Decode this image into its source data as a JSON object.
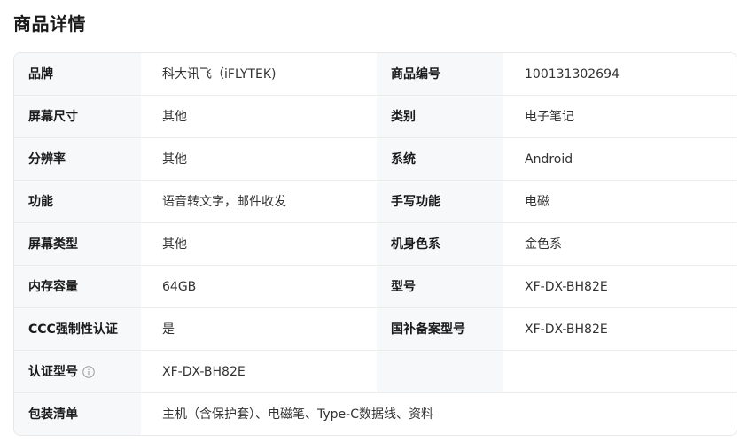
{
  "section": {
    "title": "商品详情"
  },
  "specs": {
    "rows": [
      {
        "l1": "品牌",
        "v1": "科大讯飞（iFLYTEK)",
        "l2": "商品编号",
        "v2": "100131302694"
      },
      {
        "l1": "屏幕尺寸",
        "v1": "其他",
        "l2": "类别",
        "v2": "电子笔记"
      },
      {
        "l1": "分辨率",
        "v1": "其他",
        "l2": "系统",
        "v2": "Android"
      },
      {
        "l1": "功能",
        "v1": "语音转文字，邮件收发",
        "l2": "手写功能",
        "v2": "电磁"
      },
      {
        "l1": "屏幕类型",
        "v1": "其他",
        "l2": "机身色系",
        "v2": "金色系"
      },
      {
        "l1": "内存容量",
        "v1": "64GB",
        "l2": "型号",
        "v2": "XF-DX-BH82E"
      },
      {
        "l1": "CCC强制性认证",
        "v1": "是",
        "l2": "国补备案型号",
        "v2": "XF-DX-BH82E"
      },
      {
        "l1": "认证型号",
        "v1": "XF-DX-BH82E",
        "l2": "",
        "v2": ""
      },
      {
        "l1": "包装清单",
        "v1": "主机（含保护套）、电磁笔、Type-C数据线、资料"
      }
    ],
    "info_icon": "info-circle-icon"
  }
}
